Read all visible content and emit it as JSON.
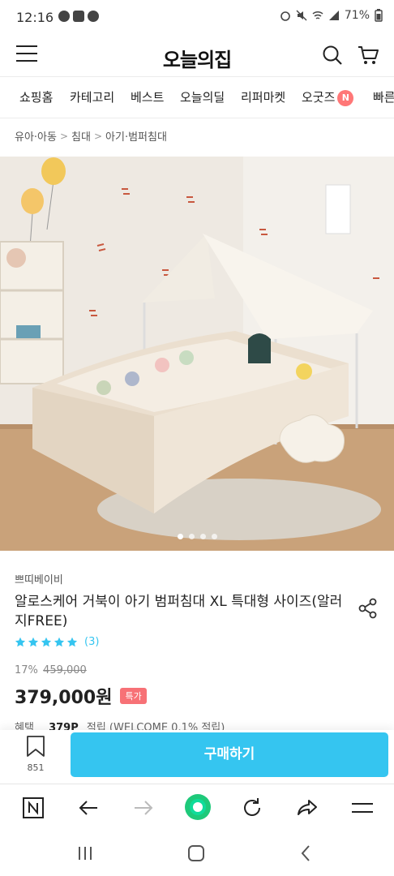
{
  "status": {
    "time": "12:16",
    "battery": "71%"
  },
  "header": {
    "logo": "오늘의집"
  },
  "tabs": [
    {
      "label": "쇼핑홈"
    },
    {
      "label": "카테고리"
    },
    {
      "label": "베스트"
    },
    {
      "label": "오늘의딜"
    },
    {
      "label": "리퍼마켓"
    },
    {
      "label": "오굿즈",
      "badge": "N"
    },
    {
      "label": "빠른"
    }
  ],
  "breadcrumb": [
    "유아·아동",
    "침대",
    "아기·범퍼침대"
  ],
  "carousel": {
    "total": 4,
    "active": 1
  },
  "product": {
    "brand": "쁘띠베이비",
    "title": "알로스케어 거북이 아기 범퍼침대 XL 특대형 사이즈(알러지FREE)",
    "rating": 5,
    "review_count": "(3)",
    "discount": "17%",
    "original_price": "459,000",
    "price": "379,000원",
    "special_badge": "특가",
    "benefit_label": "혜택",
    "benefit_points": "379P",
    "benefit_text": "적립 (WELCOME 0.1% 적립)"
  },
  "actions": {
    "bookmark_count": "851",
    "buy_label": "구매하기"
  },
  "colors": {
    "accent": "#35c5f0",
    "badge": "#f77176"
  },
  "icons": [
    "hamburger-icon",
    "search-icon",
    "cart-icon",
    "share-icon",
    "star-icon",
    "bookmark-icon"
  ]
}
